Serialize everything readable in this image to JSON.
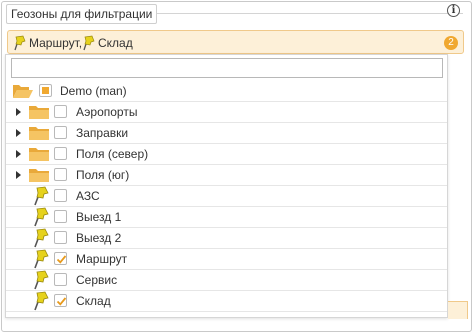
{
  "panel": {
    "title": "Геозоны для фильтрации",
    "info_icon": "info-icon",
    "info_glyph": "i"
  },
  "selection": {
    "items": [
      {
        "label": "Маршрут,",
        "icon": "pin-icon"
      },
      {
        "label": "Склад",
        "icon": "pin-icon"
      }
    ],
    "count": "2"
  },
  "search": {
    "value": "",
    "placeholder": ""
  },
  "tree": {
    "rows": [
      {
        "label": "Demo (man)",
        "type": "folder-open",
        "expandable": false,
        "checked": "partial"
      },
      {
        "label": "Аэропорты",
        "type": "folder",
        "expandable": true,
        "checked": false
      },
      {
        "label": "Заправки",
        "type": "folder",
        "expandable": true,
        "checked": false
      },
      {
        "label": "Поля (север)",
        "type": "folder",
        "expandable": true,
        "checked": false
      },
      {
        "label": "Поля (юг)",
        "type": "folder",
        "expandable": true,
        "checked": false
      },
      {
        "label": "АЗС",
        "type": "geofence",
        "expandable": false,
        "checked": false
      },
      {
        "label": "Выезд 1",
        "type": "geofence",
        "expandable": false,
        "checked": false
      },
      {
        "label": "Выезд 2",
        "type": "geofence",
        "expandable": false,
        "checked": false
      },
      {
        "label": "Маршрут",
        "type": "geofence",
        "expandable": false,
        "checked": true
      },
      {
        "label": "Сервис",
        "type": "geofence",
        "expandable": false,
        "checked": false
      },
      {
        "label": "Склад",
        "type": "geofence",
        "expandable": false,
        "checked": true
      }
    ]
  },
  "colors": {
    "accent": "#f0a830",
    "selection_bg": "#fdf0d8",
    "folder": "#f2b84b",
    "pin": "#e6d21c",
    "check": "#e89a1c"
  }
}
